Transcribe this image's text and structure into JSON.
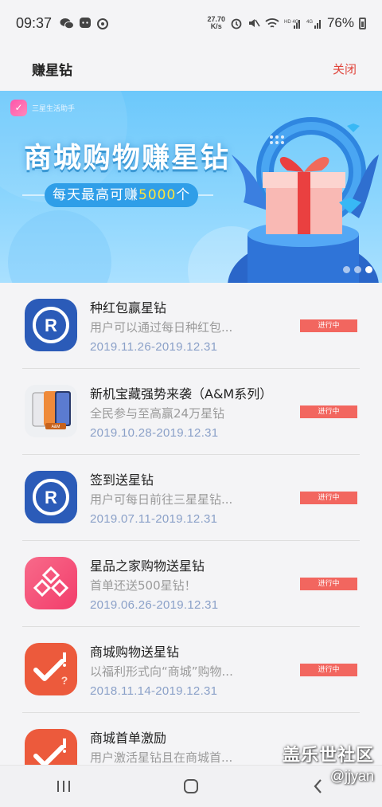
{
  "status_bar": {
    "time": "09:37",
    "speed_top": "27.70",
    "speed_bottom": "K/s",
    "battery_pct": "76%"
  },
  "header": {
    "title": "赚星钻",
    "close_label": "关闭"
  },
  "banner": {
    "logo_text": "三星生活助手",
    "headline": "商城购物赚星钻",
    "sub_prefix": "每天最高可赚",
    "sub_number": "5000",
    "sub_suffix": "个"
  },
  "activities": [
    {
      "title": "种红包赢星钻",
      "desc": "用户可以通过每日种红包...",
      "date": "2019.11.26-2019.12.31",
      "status": "进行中",
      "icon": "samsung-rewards-icon"
    },
    {
      "title": "新机宝藏强势来袭（A&M系列）",
      "desc": "全民参与至高赢24万星钻",
      "date": "2019.10.28-2019.12.31",
      "status": "进行中",
      "icon": "phone-product-icon"
    },
    {
      "title": "签到送星钻",
      "desc": "用户可每日前往三星星钻...",
      "date": "2019.07.11-2019.12.31",
      "status": "进行中",
      "icon": "samsung-rewards-icon"
    },
    {
      "title": "星品之家购物送星钻",
      "desc": "首单还送500星钻！",
      "date": "2019.06.26-2019.12.31",
      "status": "进行中",
      "icon": "diamond-shapes-icon"
    },
    {
      "title": "商城购物送星钻",
      "desc": "以福利形式向“商城”购物...",
      "date": "2018.11.14-2019.12.31",
      "status": "进行中",
      "icon": "checkmark-alert-icon"
    },
    {
      "title": "商城首单激励",
      "desc": "用户激活星钻且在商城首...",
      "date": "",
      "status": "",
      "icon": "checkmark-alert-icon"
    }
  ],
  "watermark": {
    "line1": "盖乐世社区",
    "line2": "@jjyan"
  }
}
